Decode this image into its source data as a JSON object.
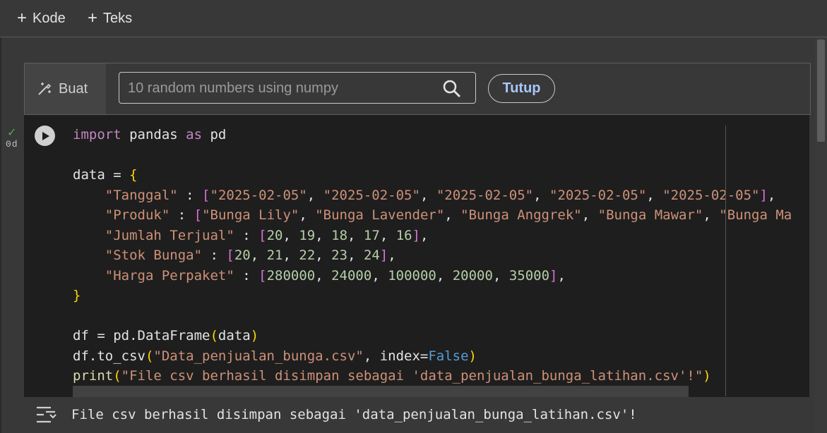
{
  "toolbar": {
    "add_code_label": "Kode",
    "add_text_label": "Teks"
  },
  "generate": {
    "buat_label": "Buat",
    "input_placeholder": "10 random numbers using numpy",
    "tutup_label": "Tutup"
  },
  "cell": {
    "status_check": "✓",
    "exec_time": "0d",
    "code_lines": [
      "import pandas as pd",
      "",
      "data = {",
      "    \"Tanggal\" : [\"2025-02-05\", \"2025-02-05\", \"2025-02-05\", \"2025-02-05\", \"2025-02-05\"],",
      "    \"Produk\" : [\"Bunga Lily\", \"Bunga Lavender\", \"Bunga Anggrek\", \"Bunga Mawar\", \"Bunga Ma",
      "    \"Jumlah Terjual\" : [20, 19, 18, 17, 16],",
      "    \"Stok Bunga\" : [20, 21, 22, 23, 24],",
      "    \"Harga Perpaket\" : [280000, 24000, 100000, 20000, 35000],",
      "}",
      "",
      "df = pd.DataFrame(data)",
      "df.to_csv(\"Data_penjualan_bunga.csv\", index=False)",
      "print(\"File csv berhasil disimpan sebagai 'data_penjualan_bunga_latihan.csv'!\")"
    ]
  },
  "output": {
    "text": "File csv berhasil disimpan sebagai 'data_penjualan_bunga_latihan.csv'!"
  },
  "colors": {
    "accent": "#a8c7fa",
    "success": "#4caf50",
    "cell_bg": "#1e1e1e",
    "page_bg": "#383838"
  },
  "icons": [
    "plus-icon",
    "magic-wand-icon",
    "search-icon",
    "play-icon",
    "check-icon",
    "output-menu-icon"
  ]
}
